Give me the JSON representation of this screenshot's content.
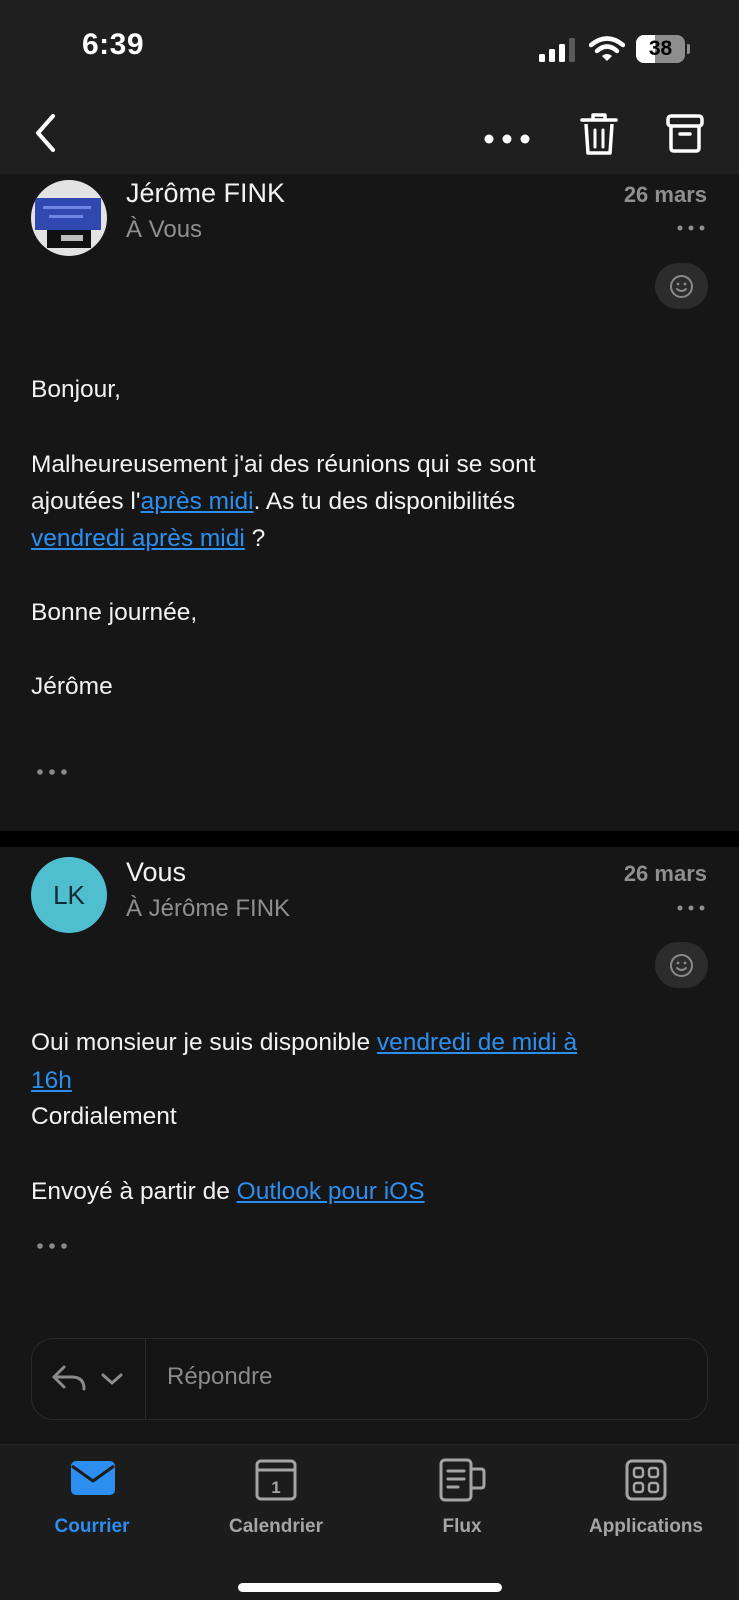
{
  "status_bar": {
    "time": "6:39",
    "battery": "38",
    "battery_level": 0.38
  },
  "toolbar": {
    "back_icon": "chevron-left-icon",
    "more_icon": "more-horizontal-icon",
    "delete_icon": "trash-icon",
    "archive_icon": "archive-icon"
  },
  "messages": [
    {
      "sender": "Jérôme FINK",
      "recipient": "À Vous",
      "date": "26 mars",
      "avatar": "photo",
      "body": {
        "greeting": "Bonjour,",
        "line1": "Malheureusement j'ai des réunions qui se sont",
        "line2_a": "ajoutées l'",
        "line2_link": "après midi",
        "line2_b": ". As tu des disponibilités",
        "line3_link": "vendredi après midi",
        "line3_b": " ?",
        "closing": "Bonne journée,",
        "signature": "Jérôme"
      }
    },
    {
      "sender": "Vous",
      "recipient": "À Jérôme FINK",
      "date": "26 mars",
      "avatar_initials": "LK",
      "body": {
        "line1_a": "Oui monsieur je suis disponible ",
        "line1_link": "vendredi de midi à",
        "line2_link": "16h",
        "line3": "Cordialement",
        "line4_a": "Envoyé à partir de ",
        "line4_link": "Outlook pour iOS"
      }
    }
  ],
  "reply": {
    "placeholder": "Répondre",
    "reply_icon": "reply-icon",
    "chevron_icon": "chevron-down-icon"
  },
  "tabs": [
    {
      "label": "Courrier",
      "icon": "mail-icon",
      "active": true
    },
    {
      "label": "Calendrier",
      "icon": "calendar-icon",
      "day": "1",
      "active": false
    },
    {
      "label": "Flux",
      "icon": "feed-icon",
      "active": false
    },
    {
      "label": "Applications",
      "icon": "apps-grid-icon",
      "active": false
    }
  ],
  "colors": {
    "accent": "#2c8ff0",
    "background": "#161616",
    "header": "#1f1f1f",
    "avatar_lk": "#4fbfcf"
  }
}
